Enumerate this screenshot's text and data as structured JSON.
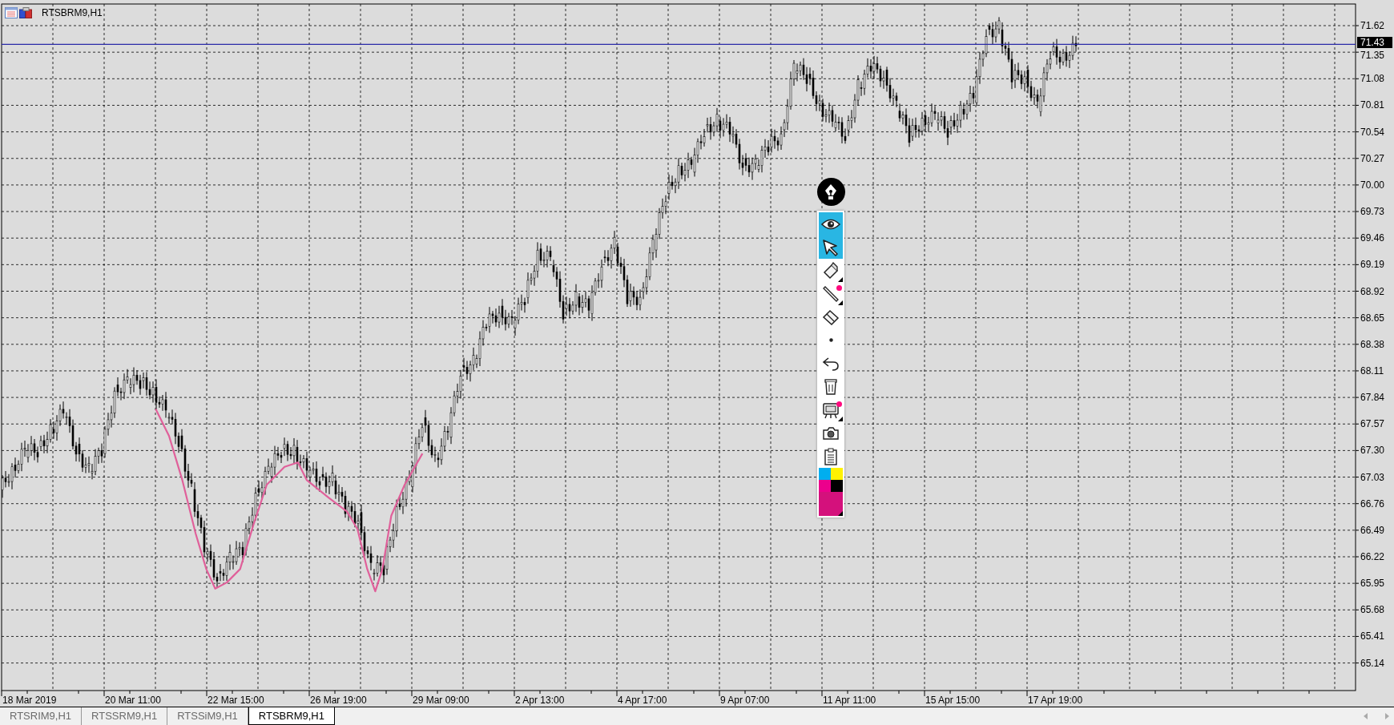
{
  "chart_title": "RTSBRM9,H1",
  "current_price": "71.43",
  "price_axis": [
    "71.62",
    "71.35",
    "71.08",
    "70.81",
    "70.54",
    "70.27",
    "70.00",
    "69.73",
    "69.46",
    "69.19",
    "68.92",
    "68.65",
    "68.38",
    "68.11",
    "67.84",
    "67.57",
    "67.30",
    "67.03",
    "66.76",
    "66.49",
    "66.22",
    "65.95",
    "65.68",
    "65.41",
    "65.14"
  ],
  "time_axis": [
    "18 Mar 2019",
    "20 Mar 11:00",
    "22 Mar 15:00",
    "26 Mar 19:00",
    "29 Mar 09:00",
    "2 Apr 13:00",
    "4 Apr 17:00",
    "9 Apr 07:00",
    "11 Apr 11:00",
    "15 Apr 15:00",
    "17 Apr 19:00"
  ],
  "toolbar": {
    "tools": [
      {
        "kind": "view",
        "selected": true,
        "has_dot": false,
        "has_submenu": false
      },
      {
        "kind": "pointer",
        "selected": true,
        "has_dot": false,
        "has_submenu": false
      },
      {
        "kind": "marker",
        "selected": false,
        "has_dot": false,
        "has_submenu": true
      },
      {
        "kind": "line",
        "selected": false,
        "has_dot": true,
        "has_submenu": true
      },
      {
        "kind": "eraser",
        "selected": false,
        "has_dot": false,
        "has_submenu": false
      },
      {
        "kind": "dot",
        "selected": false,
        "has_dot": false,
        "has_submenu": false
      },
      {
        "kind": "undo",
        "selected": false,
        "has_dot": false,
        "has_submenu": false
      },
      {
        "kind": "delete",
        "selected": false,
        "has_dot": false,
        "has_submenu": false
      },
      {
        "kind": "easel",
        "selected": false,
        "has_dot": true,
        "has_submenu": true
      },
      {
        "kind": "camera",
        "selected": false,
        "has_dot": false,
        "has_submenu": false
      },
      {
        "kind": "clipboard",
        "selected": false,
        "has_dot": false,
        "has_submenu": false
      }
    ],
    "palette": [
      {
        "color": "#00aeef"
      },
      {
        "color": "#fff200"
      },
      {
        "color": "#ec008c"
      },
      {
        "color": "#000000"
      }
    ],
    "current": {
      "color": "#d4117c"
    }
  },
  "tabs": [
    {
      "label": "RTSRIM9,H1",
      "selected": false
    },
    {
      "label": "RTSSRM9,H1",
      "selected": false
    },
    {
      "label": "RTSSiM9,H1",
      "selected": false
    },
    {
      "label": "RTSBRM9,H1",
      "selected": true
    }
  ]
}
